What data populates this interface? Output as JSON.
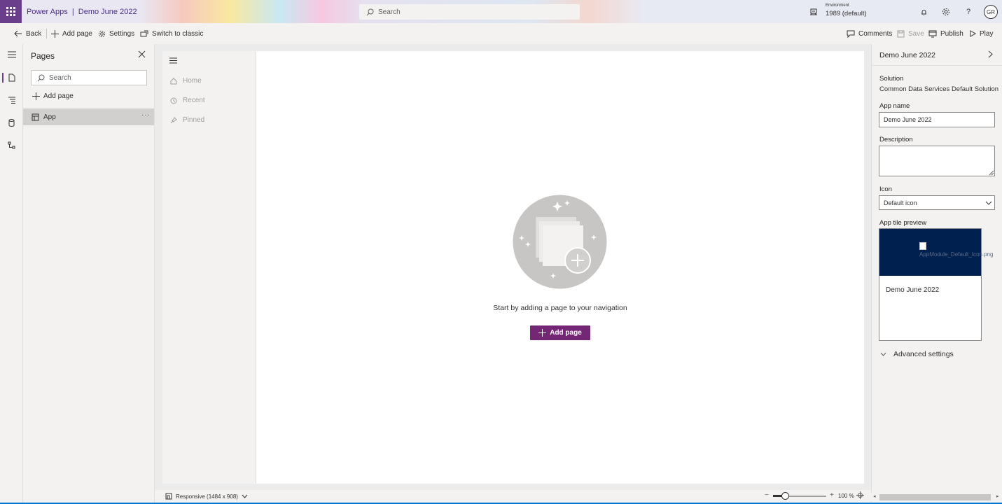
{
  "header": {
    "app_title": "Power Apps  |  Demo June 2022",
    "search_placeholder": "Search",
    "environment_label": "Environment",
    "environment_value": "1989 (default)",
    "avatar_initials": "GR"
  },
  "commandbar": {
    "back": "Back",
    "add_page": "Add page",
    "settings": "Settings",
    "switch_classic": "Switch to classic",
    "comments": "Comments",
    "save": "Save",
    "publish": "Publish",
    "play": "Play"
  },
  "pages_panel": {
    "title": "Pages",
    "search_placeholder": "Search",
    "add_page": "Add page",
    "items": [
      {
        "label": "App"
      }
    ]
  },
  "nav_pane": {
    "items": [
      {
        "label": "Home",
        "icon": "home-icon"
      },
      {
        "label": "Recent",
        "icon": "clock-icon"
      },
      {
        "label": "Pinned",
        "icon": "pin-icon"
      }
    ]
  },
  "canvas": {
    "empty_text": "Start by adding a page to your navigation",
    "add_page_button": "Add page"
  },
  "bottombar": {
    "responsive": "Responsive (1484 x 908)",
    "zoom_minus": "−",
    "zoom_plus": "+",
    "zoom_value": "100 %",
    "zoom_level_percent": 100
  },
  "right_panel": {
    "title": "Demo June 2022",
    "solution_label": "Solution",
    "solution_value": "Common Data Services Default Solution",
    "app_name_label": "App name",
    "app_name_value": "Demo June 2022",
    "description_label": "Description",
    "description_value": "",
    "icon_label": "Icon",
    "icon_value": "Default icon",
    "tile_preview_label": "App tile preview",
    "tile_image_alt": "AppModule_Default_Icon.png",
    "tile_name": "Demo June 2022",
    "advanced_settings": "Advanced settings"
  },
  "colors": {
    "brand_purple": "#742774",
    "waffle_purple": "#6b3e8c",
    "tile_navy": "#002050",
    "accent_blue": "#0078d4"
  }
}
